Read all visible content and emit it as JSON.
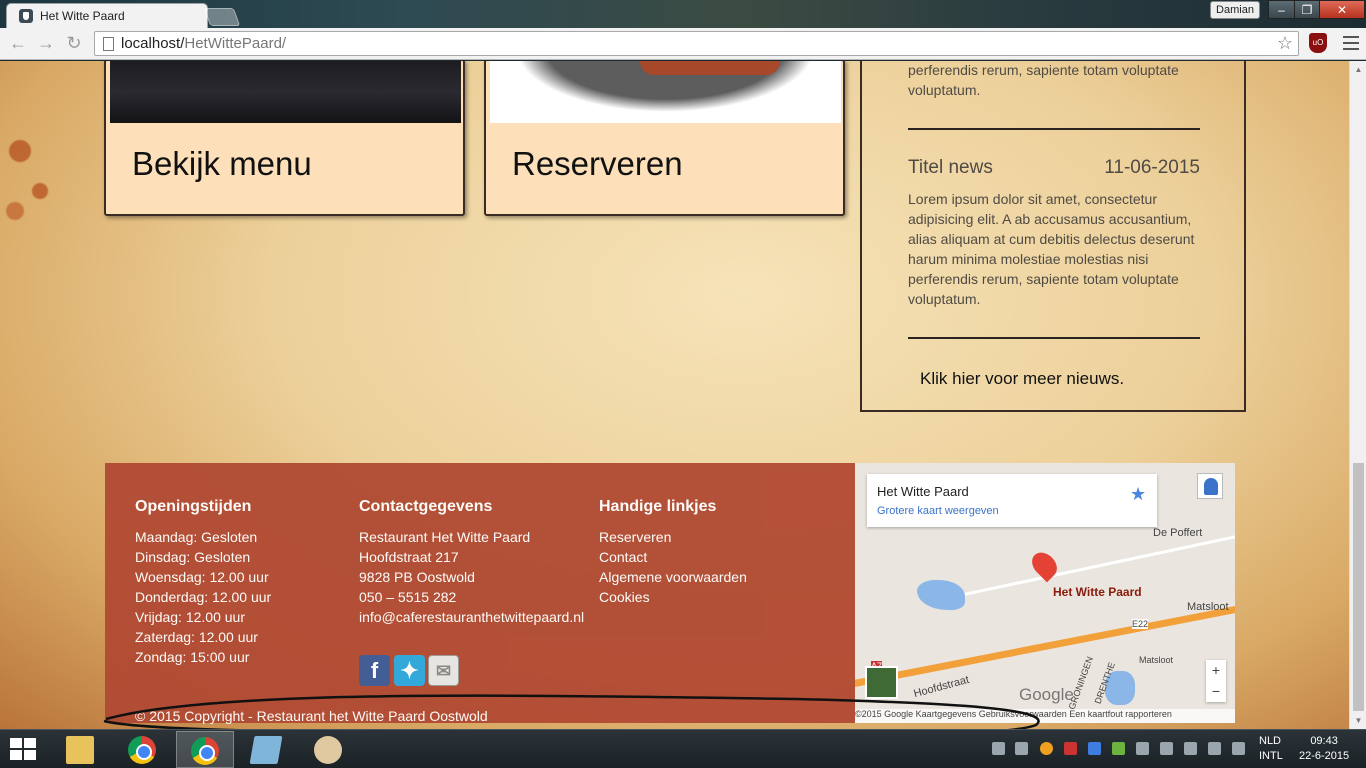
{
  "browser": {
    "tab_title": "Het Witte Paard",
    "user_name": "Damian",
    "url_host": "localhost/",
    "url_path": "HetWittePaard/",
    "ext_label": "uO"
  },
  "cards": {
    "menu_label": "Bekijk menu",
    "reserve_label": "Reserveren"
  },
  "news": {
    "top_text": "perferendis rerum, sapiente totam voluptate voluptatum.",
    "item_title": "Titel news",
    "item_date": "11-06-2015",
    "item_text": "Lorem ipsum dolor sit amet, consectetur adipisicing elit. A ab accusamus accusantium, alias aliquam at cum debitis delectus deserunt harum minima molestiae molestias nisi perferendis rerum, sapiente totam voluptate voluptatum.",
    "more_link": "Klik hier voor meer nieuws."
  },
  "footer": {
    "hours_heading": "Openingstijden",
    "hours": [
      "Maandag: Gesloten",
      "Dinsdag: Gesloten",
      "Woensdag: 12.00 uur",
      "Donderdag: 12.00 uur",
      "Vrijdag: 12.00 uur",
      "Zaterdag: 12.00 uur",
      "Zondag: 15:00 uur"
    ],
    "contact_heading": "Contactgegevens",
    "contact": [
      "Restaurant Het Witte Paard",
      "Hoofdstraat 217",
      "9828 PB Oostwold",
      "050 – 5515 282",
      "info@caferestauranthetwittepaard.nl"
    ],
    "links_heading": "Handige linkjes",
    "links": [
      "Reserveren",
      "Contact",
      "Algemene voorwaarden",
      "Cookies"
    ],
    "social": [
      "facebook-icon",
      "twitter-icon",
      "mail-icon"
    ],
    "copyright": "© 2015 Copyright - Restaurant het Witte Paard Oostwold"
  },
  "map": {
    "place_title": "Het Witte Paard",
    "larger_map_link": "Grotere kaart weergeven",
    "pin_label": "Het Witte Paard",
    "labels": [
      "De Poffert",
      "Matsloot",
      "Hoofdstraat",
      "E22",
      "A7",
      "GRONINGEN",
      "DRENTHE",
      "Matsloot"
    ],
    "zoom_in": "+",
    "zoom_out": "−",
    "logo": "Google",
    "terms": "©2015 Google   Kaartgegevens   Gebruiksvoorwaarden   Een kaartfout rapporteren"
  },
  "taskbar": {
    "lang_line1": "NLD",
    "lang_line2": "INTL",
    "time": "09:43",
    "date": "22-6-2015"
  }
}
